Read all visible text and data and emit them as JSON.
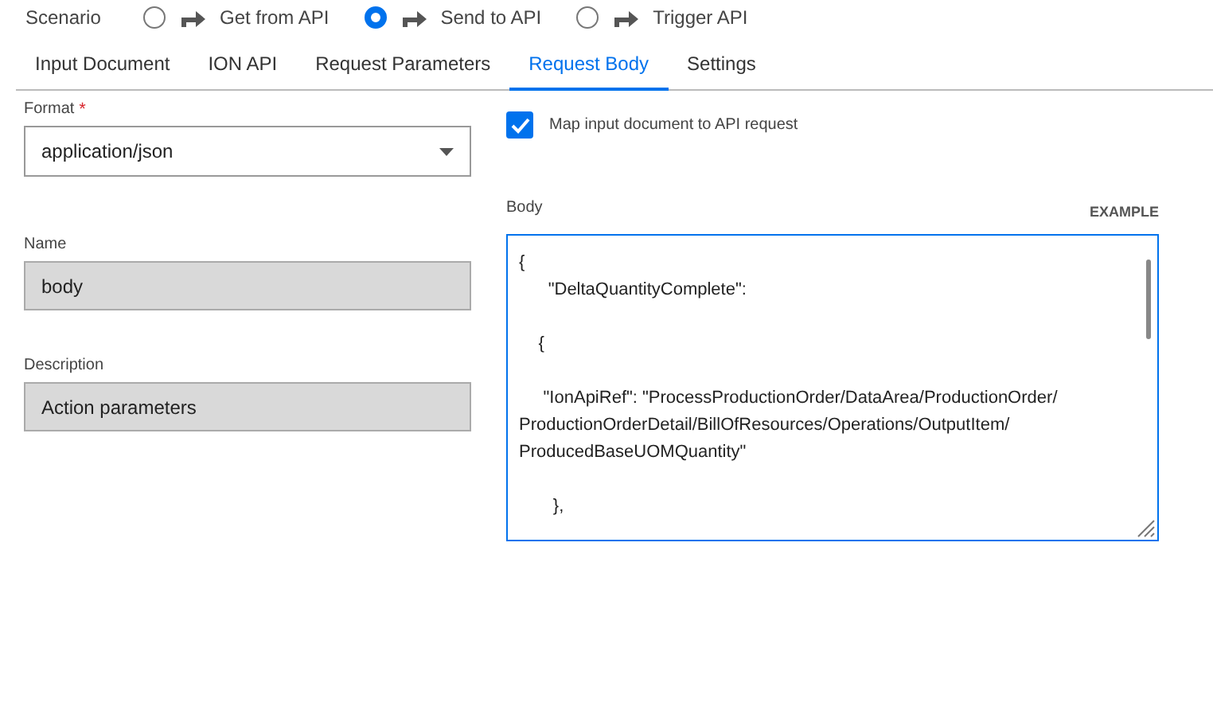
{
  "scenario": {
    "label": "Scenario",
    "options": [
      {
        "label": "Get from API",
        "selected": false
      },
      {
        "label": "Send to API",
        "selected": true
      },
      {
        "label": "Trigger API",
        "selected": false
      }
    ]
  },
  "tabs": [
    {
      "label": "Input Document",
      "selected": false
    },
    {
      "label": "ION API",
      "selected": false
    },
    {
      "label": "Request Parameters",
      "selected": false
    },
    {
      "label": "Request Body",
      "selected": true
    },
    {
      "label": "Settings",
      "selected": false
    }
  ],
  "format": {
    "label": "Format",
    "required_mark": "*",
    "value": "application/json"
  },
  "name": {
    "label": "Name",
    "value": "body",
    "disabled": true
  },
  "description": {
    "label": "Description",
    "value": "Action parameters",
    "disabled": true
  },
  "map_checkbox": {
    "label": "Map input document to API request",
    "checked": true
  },
  "body": {
    "label": "Body",
    "example": "EXAMPLE",
    "lines": [
      {
        "text": "{",
        "blank_after": false
      },
      {
        "text": "      \"DeltaQuantityComplete\":",
        "blank_after": true
      },
      {
        "text": "    {",
        "blank_after": true
      },
      {
        "text": "     \"IonApiRef\": \"ProcessProductionOrder/DataArea/ProductionOrder/ProductionOrderDetail/BillOfResources/Operations/OutputItem/ProducedBaseUOMQuantity\"",
        "blank_after": true
      },
      {
        "text": "       },",
        "blank_after": false
      }
    ]
  }
}
